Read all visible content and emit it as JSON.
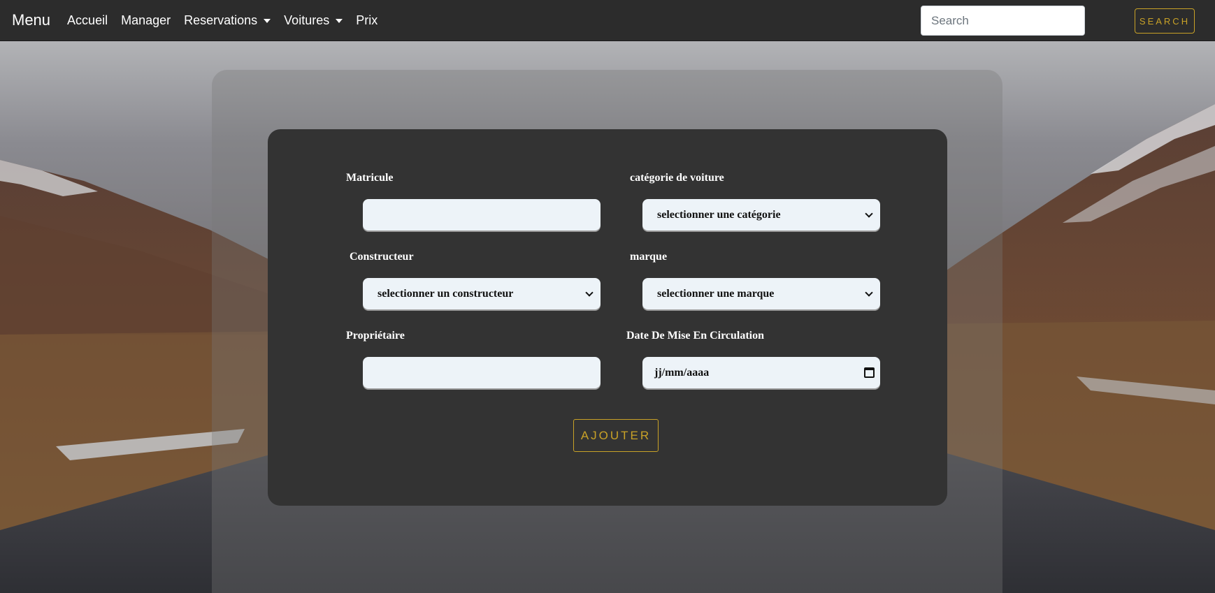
{
  "navbar": {
    "brand": "Menu",
    "links": [
      {
        "label": "Accueil"
      },
      {
        "label": "Manager"
      },
      {
        "label": "Reservations"
      },
      {
        "label": "Voitures"
      },
      {
        "label": "Prix"
      }
    ],
    "search_placeholder": "Search",
    "search_button": "SEARCH"
  },
  "form": {
    "matricule_label": "Matricule",
    "categorie_label": "catégorie de voiture",
    "categorie_selected": "selectionner une catégorie",
    "constructeur_label": "Constructeur",
    "constructeur_selected": "selectionner un constructeur",
    "marque_label": "marque",
    "marque_selected": "selectionner une marque",
    "proprietaire_label": "Propriétaire",
    "date_label": "Date De Mise En Circulation",
    "date_placeholder": "jj/mm/aaaa",
    "submit": "AJOUTER"
  },
  "colors": {
    "accent": "#c9a227",
    "navbar_bg": "#2c2c2c",
    "card_bg": "#333333",
    "field_bg": "#edf3f8"
  }
}
